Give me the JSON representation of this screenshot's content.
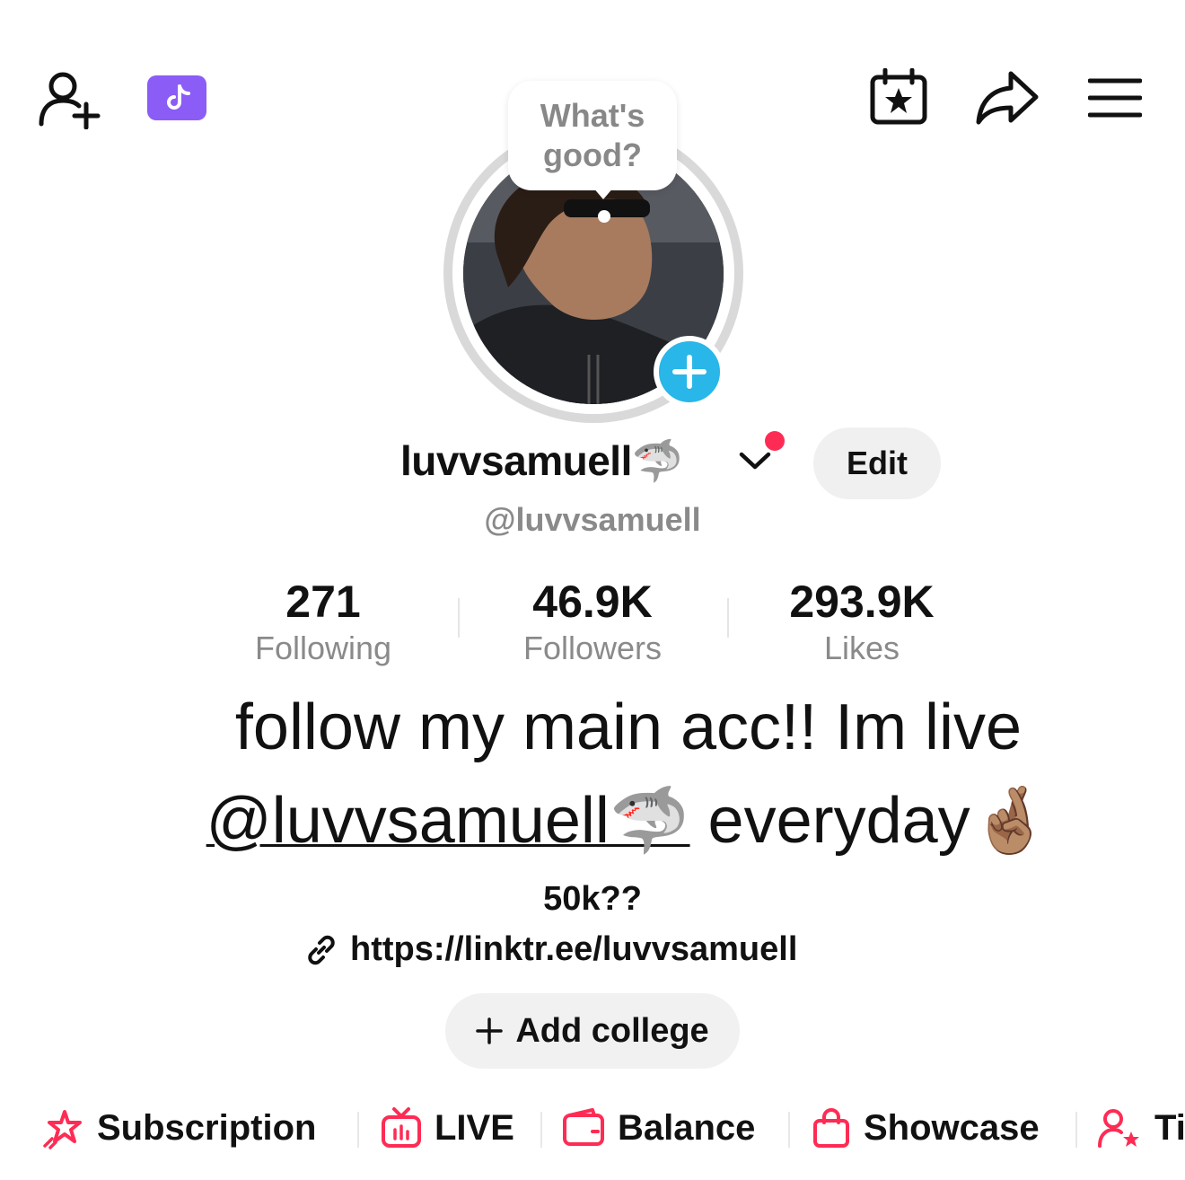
{
  "header": {
    "add_friend_icon": "person-plus-icon",
    "tiktok_badge_icon": "tiktok-note-icon",
    "calendar_icon": "calendar-star-icon",
    "share_icon": "share-arrow-icon",
    "menu_icon": "hamburger-menu-icon",
    "badge_color": "#8b5cf6"
  },
  "profile": {
    "note_bubble": "What's\ngood?",
    "display_name": "luvvsamuell🦈",
    "username": "@luvvsamuell",
    "edit_label": "Edit",
    "add_story_color": "#29b6e8",
    "notification_dot_color": "#fe2c55"
  },
  "stats": [
    {
      "value": "271",
      "label": "Following"
    },
    {
      "value": "46.9K",
      "label": "Followers"
    },
    {
      "value": "293.9K",
      "label": "Likes"
    }
  ],
  "bio": {
    "line1": "follow my main acc!! Im live",
    "mention": "@luvvsamuell🦈",
    "line2_suffix": " everyday🤞🏽",
    "sub_line": "50k??",
    "link": "https://linktr.ee/luvvsamuell",
    "add_college_label": "Add college"
  },
  "tabs": [
    {
      "label": "Subscription",
      "icon": "star-rocket-icon"
    },
    {
      "label": "LIVE",
      "icon": "tv-icon"
    },
    {
      "label": "Balance",
      "icon": "wallet-icon"
    },
    {
      "label": "Showcase",
      "icon": "shopping-bag-icon"
    },
    {
      "label": "Ti",
      "icon": "person-star-icon"
    }
  ],
  "tab_icon_color": "#fe2c55"
}
